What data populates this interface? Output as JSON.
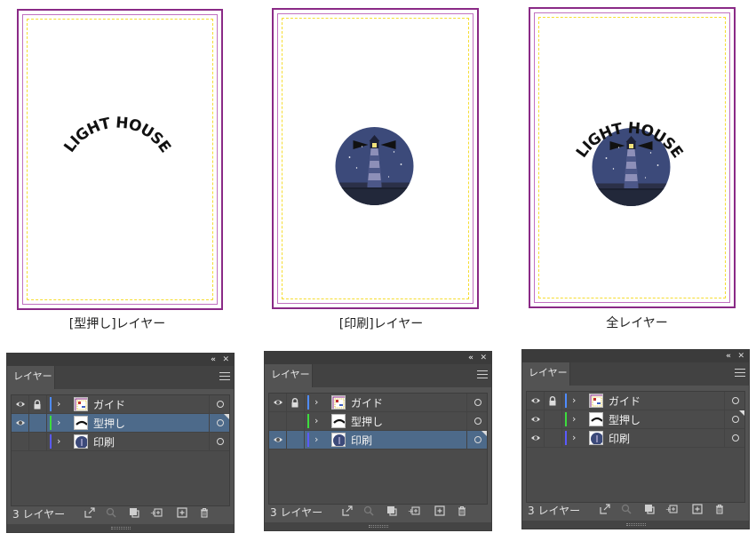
{
  "columns": [
    {
      "caption": "[型押し]レイヤー",
      "show_logo": true,
      "show_lighthouse": false,
      "logo_text": "LIGHT HOUSE",
      "panel": {
        "tab": "レイヤー",
        "count": "3 レイヤー",
        "layers": [
          {
            "name": "ガイド",
            "eye": true,
            "lock": true,
            "color": "#4f8cff",
            "selected": false,
            "thumb": "guide"
          },
          {
            "name": "型押し",
            "eye": true,
            "lock": false,
            "color": "#3ddc3d",
            "selected": true,
            "thumb": "logo"
          },
          {
            "name": "印刷",
            "eye": false,
            "lock": false,
            "color": "#5a5aff",
            "selected": false,
            "thumb": "circle"
          }
        ]
      }
    },
    {
      "caption": "[印刷]レイヤー",
      "show_logo": false,
      "show_lighthouse": true,
      "logo_text": "LIGHT HOUSE",
      "panel": {
        "tab": "レイヤー",
        "count": "3 レイヤー",
        "layers": [
          {
            "name": "ガイド",
            "eye": true,
            "lock": true,
            "color": "#4f8cff",
            "selected": false,
            "thumb": "guide"
          },
          {
            "name": "型押し",
            "eye": false,
            "lock": false,
            "color": "#3ddc3d",
            "selected": false,
            "thumb": "logo"
          },
          {
            "name": "印刷",
            "eye": true,
            "lock": false,
            "color": "#5a5aff",
            "selected": true,
            "thumb": "circle"
          }
        ]
      }
    },
    {
      "caption": "全レイヤー",
      "show_logo": true,
      "show_lighthouse": true,
      "logo_text": "LIGHT HOUSE",
      "panel": {
        "tab": "レイヤー",
        "count": "3 レイヤー",
        "layers": [
          {
            "name": "ガイド",
            "eye": true,
            "lock": true,
            "color": "#4f8cff",
            "selected": false,
            "thumb": "guide"
          },
          {
            "name": "型押し",
            "eye": true,
            "lock": false,
            "color": "#3ddc3d",
            "selected": false,
            "thumb": "logo"
          },
          {
            "name": "印刷",
            "eye": true,
            "lock": false,
            "color": "#5a5aff",
            "selected": false,
            "thumb": "circle"
          }
        ]
      }
    }
  ],
  "icons": {
    "collapse": "«",
    "close": "✕",
    "chevron": "›"
  },
  "colors": {
    "doc_border": "#8a2a86",
    "guide": "#f6dd30",
    "lighthouse_bg": "#3c4a7a",
    "selected_row": "#4d6a8a"
  }
}
